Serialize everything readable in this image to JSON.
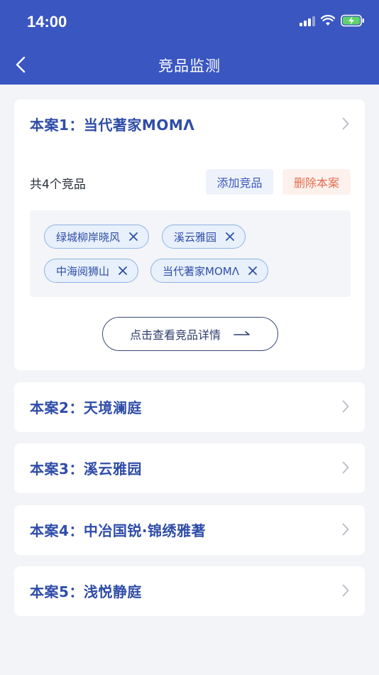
{
  "status": {
    "time": "14:00"
  },
  "nav": {
    "title": "竞品监测"
  },
  "cases": [
    {
      "title": "本案1：当代著家MOMΛ",
      "count_label": "共4个竞品",
      "add_label": "添加竞品",
      "delete_label": "删除本案",
      "tags": [
        "绿城柳岸晓风",
        "溪云雅园",
        "中海阅狮山",
        "当代著家MOMΛ"
      ],
      "detail_label": "点击查看竞品详情"
    },
    {
      "title": "本案2：天境澜庭"
    },
    {
      "title": "本案3：溪云雅园"
    },
    {
      "title": "本案4：中冶国锐·锦绣雅著"
    },
    {
      "title": "本案5：浅悦静庭"
    }
  ],
  "colors": {
    "primary": "#3a56c1",
    "danger": "#e0704f",
    "background": "#f3f4f7"
  }
}
